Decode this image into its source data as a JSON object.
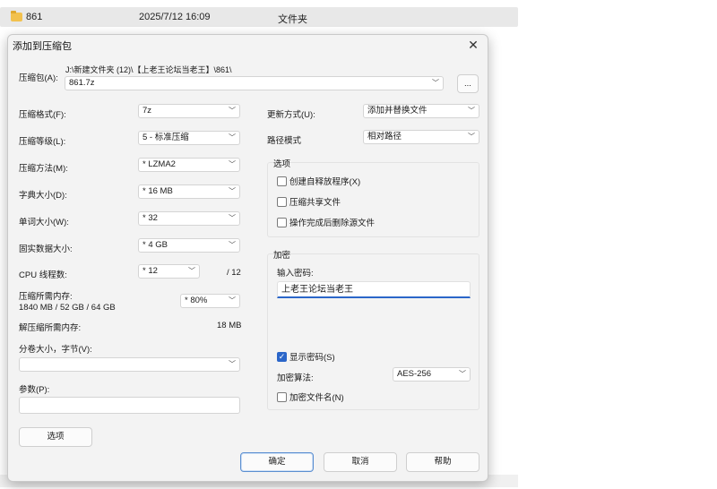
{
  "explorer": {
    "row": {
      "name": "861",
      "date": "2025/7/12 16:09",
      "type": "文件夹"
    }
  },
  "dialog": {
    "title": "添加到压缩包",
    "close_glyph": "✕",
    "archive": {
      "label": "压缩包(A):",
      "path": "J:\\新建文件夹 (12)\\【上老王论坛当老王】\\861\\",
      "value": "861.7z",
      "browse_label": "..."
    },
    "left": {
      "format": {
        "label": "压缩格式(F):",
        "value": "7z"
      },
      "level": {
        "label": "压缩等级(L):",
        "value": "5 - 标准压缩"
      },
      "method": {
        "label": "压缩方法(M):",
        "value": "* LZMA2"
      },
      "dict": {
        "label": "字典大小(D):",
        "value": "* 16 MB"
      },
      "word": {
        "label": "单词大小(W):",
        "value": "* 32"
      },
      "solid": {
        "label": "固实数据大小:",
        "value": "* 4 GB"
      },
      "cpu": {
        "label": "CPU 线程数:",
        "value": "* 12",
        "max": "/ 12"
      },
      "mem_compress": {
        "label": "压缩所需内存:",
        "detail": "1840 MB / 52 GB / 64 GB",
        "value": "* 80%"
      },
      "mem_decompress": {
        "label": "解压缩所需内存:",
        "value": "18 MB"
      },
      "split": {
        "label": "分卷大小，字节(V):",
        "value": ""
      },
      "params": {
        "label": "参数(P):",
        "value": ""
      },
      "options_button": "选项"
    },
    "right": {
      "update": {
        "label": "更新方式(U):",
        "value": "添加并替换文件"
      },
      "pathmode": {
        "label": "路径模式",
        "value": "相对路径"
      },
      "options_group": {
        "title": "选项",
        "sfx": {
          "label": "创建自释放程序(X)",
          "checked": false
        },
        "shared": {
          "label": "压缩共享文件",
          "checked": false
        },
        "delete": {
          "label": "操作完成后删除源文件",
          "checked": false
        }
      },
      "encrypt_group": {
        "title": "加密",
        "pwd_label": "输入密码:",
        "pwd_value": "上老王论坛当老王",
        "show": {
          "label": "显示密码(S)",
          "checked": true
        },
        "method_label": "加密算法:",
        "method_value": "AES-256",
        "encrypt_names": {
          "label": "加密文件名(N)",
          "checked": false
        }
      }
    },
    "buttons": {
      "ok": "确定",
      "cancel": "取消",
      "help": "帮助"
    }
  },
  "icons": {
    "dropdown": "chevron-down-icon",
    "check": "checkmark-icon",
    "folder": "folder-icon"
  },
  "colors": {
    "accent": "#2b66c9",
    "folder": "#f2c14e"
  }
}
